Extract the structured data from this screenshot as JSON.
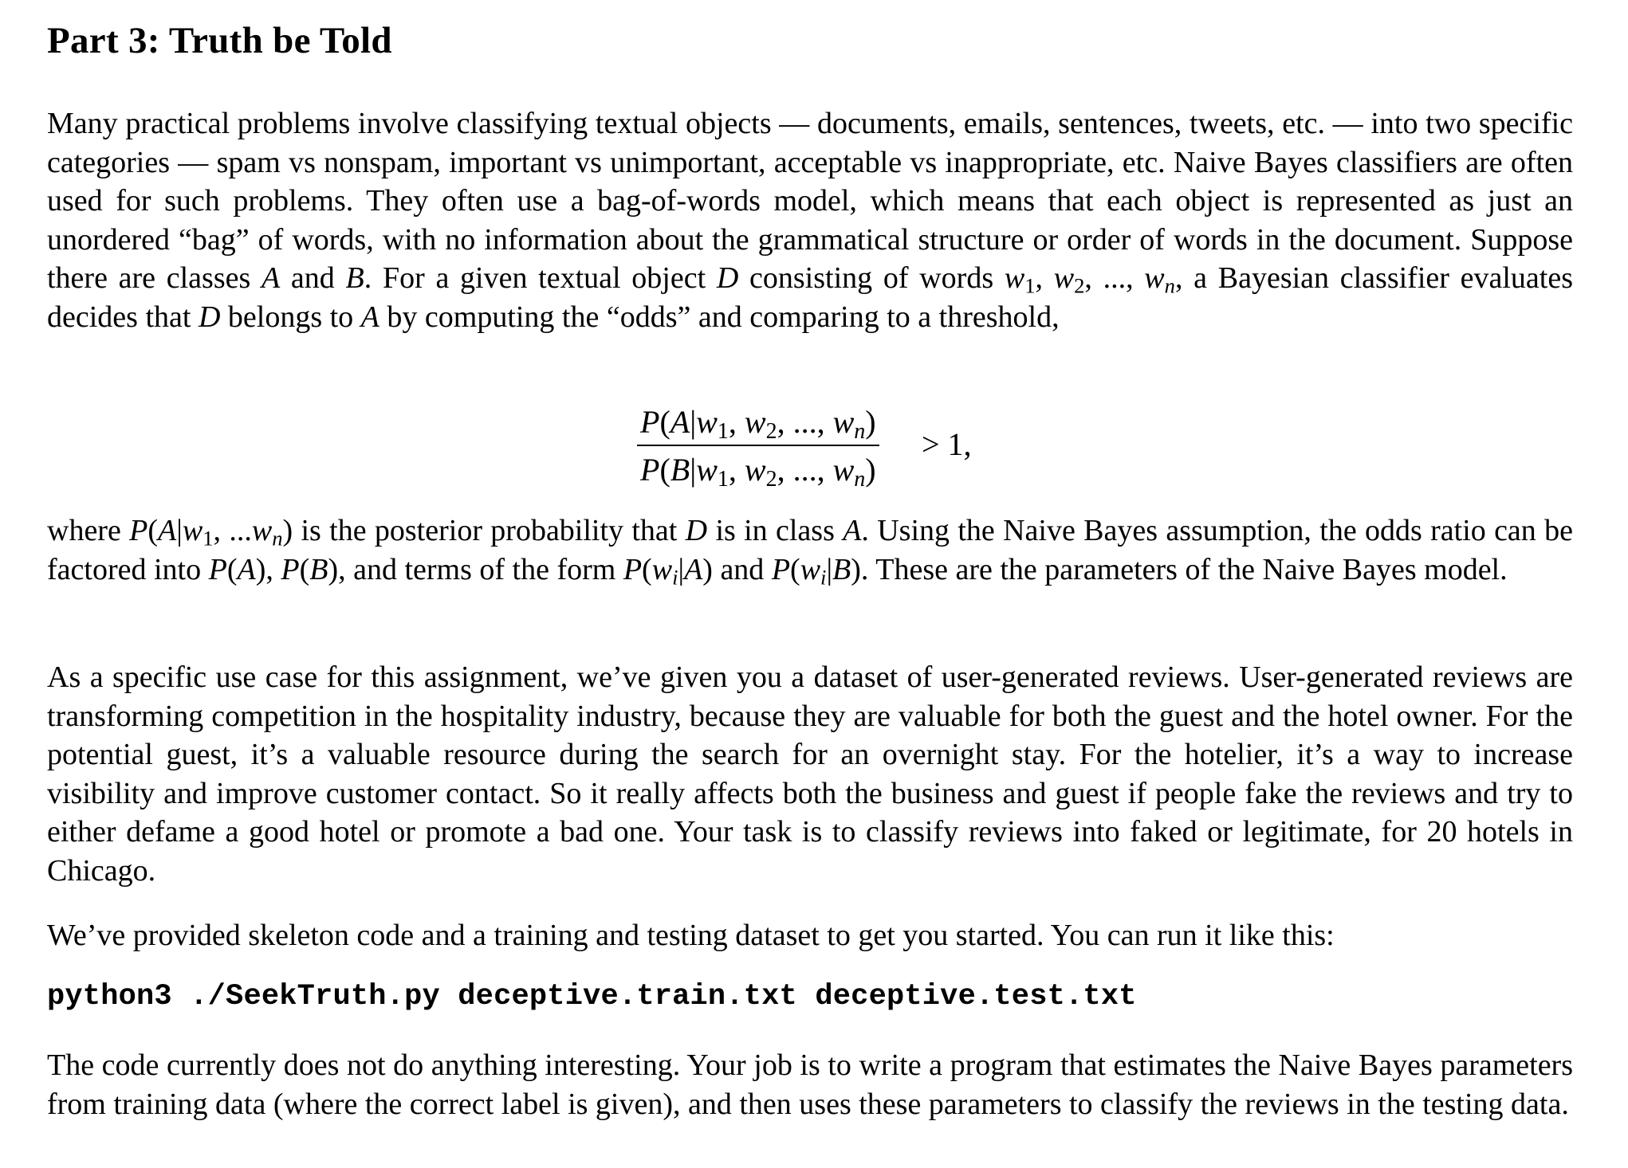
{
  "section_title": "Part 3: Truth be Told",
  "paragraph1": {
    "s1": "Many practical problems involve classifying textual objects — documents, emails, sentences, tweets, etc. — into two specific categories — spam vs nonspam, important vs unimportant, acceptable vs inappropriate, etc. Naive Bayes classifiers are often used for such problems. They often use a bag-of-words model, which means that each object is represented as just an unordered “bag” of words, with no information about the grammatical structure or order of words in the document. Suppose there are classes ",
    "A": "A",
    "and": " and ",
    "B": "B",
    "s2": ". For a given textual object ",
    "D": "D",
    "s3": " consisting of words ",
    "words": "w",
    "s4": ", a Bayesian classifier evaluates decides that ",
    "D2": "D",
    "s5": " belongs to ",
    "A2": "A",
    "s6": " by computing the “odds” and comparing to a threshold,"
  },
  "equation": {
    "numerator": "P(A|w₁, w₂, ..., wₙ)",
    "denominator": "P(B|w₁, w₂, ..., wₙ)",
    "relation": "> 1,"
  },
  "paragraph2": {
    "s1": "where ",
    "post": "P(A|w₁, ...wₙ)",
    "s2": " is the posterior probability that ",
    "D": "D",
    "s3": " is in class ",
    "A": "A",
    "s4": ". Using the Naive Bayes assumption, the odds ratio can be factored into ",
    "PA": "P(A)",
    "s5": ", ",
    "PB": "P(B)",
    "s6": ", and terms of the form ",
    "PwA": "P(wᵢ|A)",
    "s7": " and ",
    "PwB": "P(wᵢ|B)",
    "s8": ". These are the parameters of the Naive Bayes model."
  },
  "paragraph3": "As a specific use case for this assignment, we’ve given you a dataset of user-generated reviews. User-generated reviews are transforming competition in the hospitality industry, because they are valuable for both the guest and the hotel owner. For the potential guest, it’s a valuable resource during the search for an overnight stay. For the hotelier, it’s a way to increase visibility and improve customer contact. So it really affects both the business and guest if people fake the reviews and try to either defame a good hotel or promote a bad one. Your task is to classify reviews into faked or legitimate, for 20 hotels in Chicago.",
  "paragraph4": "We’ve provided skeleton code and a training and testing dataset to get you started. You can run it like this:",
  "command": "python3 ./SeekTruth.py deceptive.train.txt deceptive.test.txt",
  "paragraph5": "The code currently does not do anything interesting. Your job is to write a program that estimates the Naive Bayes parameters from training data (where the correct label is given), and then uses these parameters to classify the reviews in the testing data."
}
